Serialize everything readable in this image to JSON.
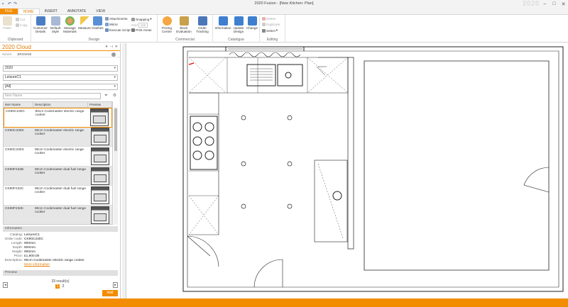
{
  "window": {
    "title": "2020 Fusion - [New Kitchen: Plan]",
    "brand": "2020",
    "controls": [
      "minimize",
      "maximize",
      "close"
    ]
  },
  "tabs": [
    {
      "label": "FILE"
    },
    {
      "label": "HOME"
    },
    {
      "label": "INSERT"
    },
    {
      "label": "ANNOTATE"
    },
    {
      "label": "VIEW"
    }
  ],
  "ribbon": {
    "clipboard": {
      "label": "Clipboard",
      "paste": "Paste",
      "cut": "Cut",
      "copy": "Copy"
    },
    "design": {
      "label": "Design",
      "customer_details": "Customer Details",
      "default_style": "Default Style",
      "manage_materials": "Manage Materials",
      "measure": "Measure",
      "clashes": "Clashes",
      "attachments": "Attachments",
      "mirror": "Mirror",
      "execute_script": "Execute Script",
      "snapping": "Snapping",
      "grid_label": "Grid",
      "grid_value": "100",
      "print_areas": "Print Areas"
    },
    "commercial": {
      "label": "Commercial",
      "pricing_centre": "Pricing Centre",
      "block_evaluation": "Block Evaluation",
      "order_tracking": "Order Tracking"
    },
    "catalogue": {
      "label": "Catalogue",
      "information": "Information",
      "update_design": "Update Design",
      "change": "Change"
    },
    "editing": {
      "label": "Editing",
      "delete": "Delete",
      "duplicate": "Duplicate",
      "select": "Select"
    }
  },
  "panel": {
    "title": "2020 Cloud",
    "subtabs": [
      "NEWS",
      "BROWSE"
    ],
    "year": "2020",
    "catalog": "LeisureC1",
    "filter": "[All]",
    "search_placeholder": "Item Name",
    "columns": [
      "Item Name",
      "Description",
      "Preview"
    ],
    "items": [
      {
        "code": "CK90C230C",
        "desc": "90cm Cookmaster electric range cooker"
      },
      {
        "code": "CK90C230K",
        "desc": "90cm Cookmaster electric range cooker"
      },
      {
        "code": "CK90C230S",
        "desc": "90cm Cookmaster electric range cooker"
      },
      {
        "code": "CK90F232B",
        "desc": "90cm Cookmaster dual fuel range cooker"
      },
      {
        "code": "CK90F232C",
        "desc": "90cm Cookmaster dual fuel range cooker"
      },
      {
        "code": "CK90F232K",
        "desc": "90cm Cookmaster dual fuel range cooker"
      }
    ],
    "information": {
      "header": "Information",
      "catalog_k": "Catalog:",
      "catalog_v": "LeisureC1",
      "order_k": "Order code:",
      "order_v": "CK90C230C",
      "length_k": "Length:",
      "length_v": "900mm",
      "depth_k": "Depth:",
      "depth_v": "600mm",
      "height_k": "Height:",
      "height_v": "900mm",
      "price_k": "Price:",
      "price_v": "£1,900.00",
      "desc_k": "Description:",
      "desc_v": "90cm Cookmaster electric range cooker",
      "more": "More information"
    },
    "preview_header": "Preview",
    "results": "33 result(s)",
    "pages": [
      "1",
      "2"
    ],
    "add": "Add"
  }
}
